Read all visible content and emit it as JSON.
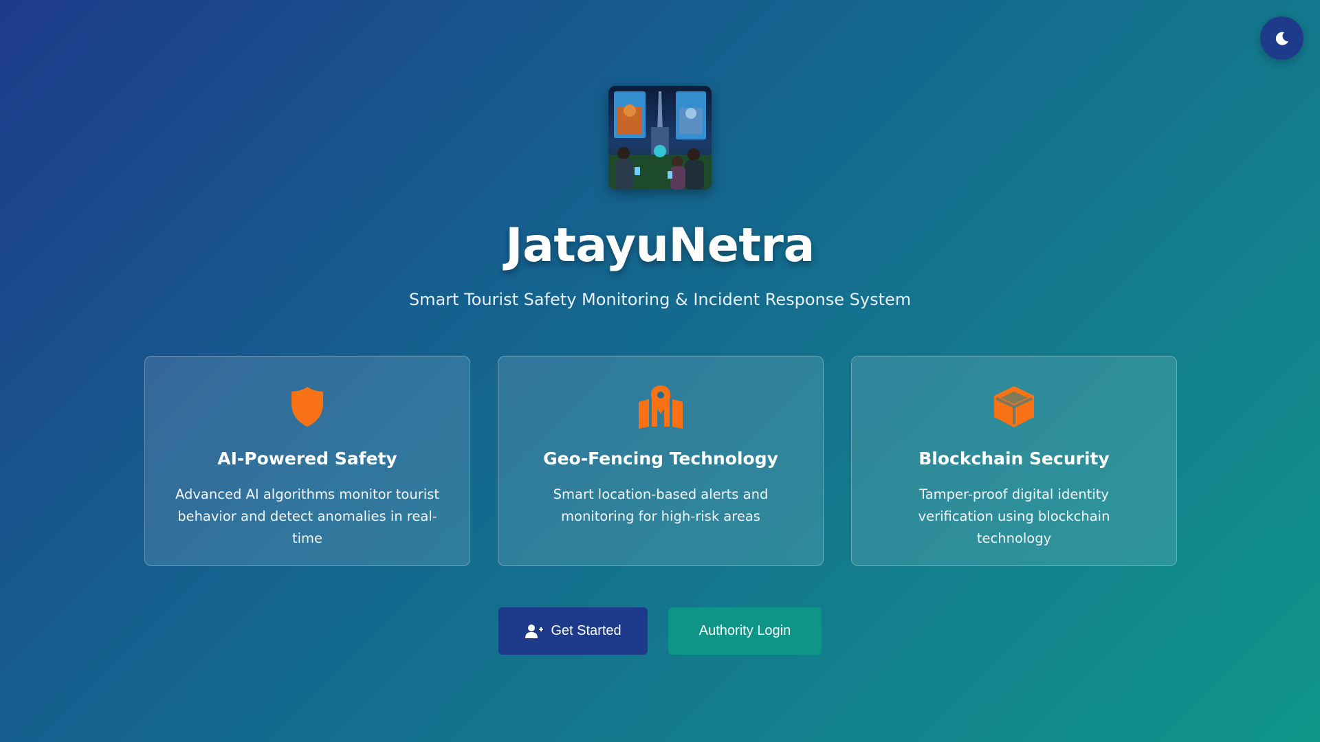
{
  "app": {
    "name": "JatayuNetra",
    "tagline": "Smart Tourist Safety Monitoring & Incident Response System"
  },
  "theme_toggle": {
    "icon": "moon-icon"
  },
  "features": [
    {
      "icon": "shield-icon",
      "title": "AI-Powered Safety",
      "description": "Advanced AI algorithms monitor tourist behavior and detect anomalies in real-time"
    },
    {
      "icon": "map-pin-icon",
      "title": "Geo-Fencing Technology",
      "description": "Smart location-based alerts and monitoring for high-risk areas"
    },
    {
      "icon": "cube-icon",
      "title": "Blockchain Security",
      "description": "Tamper-proof digital identity verification using blockchain technology"
    }
  ],
  "actions": {
    "get_started": "Get Started",
    "authority_login": "Authority Login"
  },
  "colors": {
    "accent_orange": "#f97316",
    "primary_button": "#1e3a8a",
    "secondary_button": "#0f9488",
    "background_start": "#1e3a8a",
    "background_end": "#0f958a"
  }
}
